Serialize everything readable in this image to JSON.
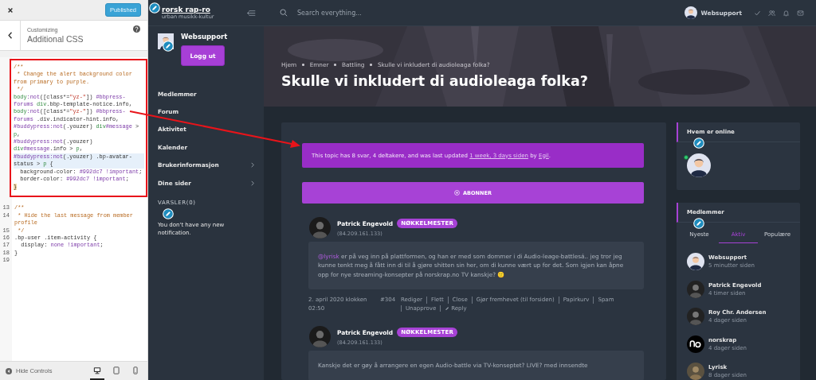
{
  "customizer": {
    "published_button": "Published",
    "breadcrumb": "Customizing",
    "title": "Additional CSS",
    "highlighted_lines": [
      {
        "active": false,
        "tokens": [
          {
            "kind": "comment",
            "t": "/**"
          }
        ]
      },
      {
        "active": false,
        "tokens": [
          {
            "kind": "comment",
            "t": " * Change the alert background color from primary to purple."
          }
        ]
      },
      {
        "active": false,
        "tokens": [
          {
            "kind": "comment",
            "t": " */"
          }
        ]
      },
      {
        "active": false,
        "tokens": [
          {
            "kind": "tag",
            "t": "body"
          },
          {
            "kind": "keyword",
            "t": ":not"
          },
          {
            "kind": "plain",
            "t": "([class*="
          },
          {
            "kind": "string",
            "t": "\"yz-\""
          },
          {
            "kind": "plain",
            "t": "]) "
          },
          {
            "kind": "keyword",
            "t": "#bbpress-forums"
          },
          {
            "kind": "tag",
            "t": " div"
          },
          {
            "kind": "plain",
            "t": ".bbp-template-notice.info,"
          }
        ]
      },
      {
        "active": false,
        "tokens": [
          {
            "kind": "tag",
            "t": "body"
          },
          {
            "kind": "keyword",
            "t": ":not"
          },
          {
            "kind": "plain",
            "t": "([class*="
          },
          {
            "kind": "string",
            "t": "\"yz-\""
          },
          {
            "kind": "plain",
            "t": "]) "
          },
          {
            "kind": "keyword",
            "t": "#bbpress-forums"
          },
          {
            "kind": "plain",
            "t": " .div.indicator-hint.info,"
          }
        ]
      },
      {
        "active": false,
        "tokens": [
          {
            "kind": "keyword",
            "t": "#buddypress"
          },
          {
            "kind": "keyword",
            "t": ":not"
          },
          {
            "kind": "plain",
            "t": "(.youzer) "
          },
          {
            "kind": "tag",
            "t": "div"
          },
          {
            "kind": "keyword",
            "t": "#message"
          },
          {
            "kind": "plain",
            "t": " > "
          },
          {
            "kind": "tag",
            "t": "p"
          },
          {
            "kind": "plain",
            "t": ","
          }
        ]
      },
      {
        "active": false,
        "tokens": [
          {
            "kind": "keyword",
            "t": "#buddypress"
          },
          {
            "kind": "keyword",
            "t": ":not"
          },
          {
            "kind": "plain",
            "t": "(.youzer) "
          },
          {
            "kind": "tag",
            "t": "div"
          },
          {
            "kind": "keyword",
            "t": "#message"
          },
          {
            "kind": "plain",
            "t": ".info > "
          },
          {
            "kind": "tag",
            "t": "p"
          },
          {
            "kind": "plain",
            "t": ","
          }
        ]
      },
      {
        "active": true,
        "tokens": [
          {
            "kind": "keyword",
            "t": "#buddypress"
          },
          {
            "kind": "keyword",
            "t": ":not"
          },
          {
            "kind": "plain",
            "t": "(.youzer) .bp-avatar-status > "
          },
          {
            "kind": "tag",
            "t": "p"
          },
          {
            "kind": "plain",
            "t": " {"
          }
        ]
      },
      {
        "active": false,
        "tokens": [
          {
            "kind": "plain",
            "t": "  background-color: "
          },
          {
            "kind": "keyword",
            "t": "#992dc7 !important"
          },
          {
            "kind": "plain",
            "t": ";"
          }
        ]
      },
      {
        "active": false,
        "tokens": [
          {
            "kind": "plain",
            "t": "  border-color: "
          },
          {
            "kind": "keyword",
            "t": "#992dc7 !important"
          },
          {
            "kind": "plain",
            "t": ";"
          }
        ]
      },
      {
        "active": false,
        "tokens": [
          {
            "kind": "bracket",
            "t": "}"
          }
        ]
      }
    ],
    "other_lines": [
      {
        "active": false
      },
      {
        "number": "13",
        "active": false,
        "tokens": [
          {
            "kind": "comment",
            "t": "/**"
          }
        ]
      },
      {
        "number": "14",
        "active": false,
        "tokens": [
          {
            "kind": "comment",
            "t": " * Hide the last message from member profile"
          }
        ]
      },
      {
        "number": "15",
        "active": false,
        "tokens": [
          {
            "kind": "comment",
            "t": " */"
          }
        ]
      },
      {
        "number": "16",
        "active": false,
        "tokens": [
          {
            "kind": "plain",
            "t": ".bp-user .item-activity {"
          }
        ]
      },
      {
        "number": "17",
        "active": false,
        "tokens": [
          {
            "kind": "plain",
            "t": "  display: "
          },
          {
            "kind": "keyword",
            "t": "none !important"
          },
          {
            "kind": "plain",
            "t": ";"
          }
        ]
      },
      {
        "number": "18",
        "active": false,
        "tokens": [
          {
            "kind": "plain",
            "t": "}"
          }
        ]
      },
      {
        "number": "19",
        "active": false
      }
    ],
    "hide_controls": "Hide Controls",
    "devices": [
      {
        "kind": "desktop",
        "selected": true
      },
      {
        "kind": "tablet",
        "selected": false
      },
      {
        "kind": "mobile",
        "selected": false
      }
    ]
  },
  "header": {
    "logo": "rorsk rap-ro",
    "tagline": "urban musikk-kultur",
    "search": {
      "placeholder": "Search everything..."
    },
    "user": "Websupport"
  },
  "sidebar": {
    "user": "Websupport",
    "logout_button": "Logg ut",
    "items": [
      {
        "label": "Medlemmer",
        "expandable": false
      },
      {
        "label": "Forum",
        "expandable": false
      },
      {
        "label": "Aktivitet",
        "expandable": false
      },
      {
        "label": "Kalender",
        "expandable": false
      },
      {
        "label": "Brukerinformasjon",
        "expandable": true
      },
      {
        "label": "Dine sider",
        "expandable": true
      }
    ],
    "notifications_heading": "VARSLER(0)",
    "notifications_text": "You don't have any new notification."
  },
  "hero": {
    "breadcrumbs": [
      "Hjem",
      "Emner",
      "Battling",
      "Skulle vi inkludert di audioleaga folka?"
    ],
    "title": "Skulle vi inkludert di audioleaga folka?"
  },
  "notice": {
    "parts": [
      {
        "text": "This topic has 8 svar, 4 deltakere, and was last updated ",
        "link": false
      },
      {
        "text": "1 week, 3 days siden",
        "link": true
      },
      {
        "text": " by ",
        "link": false
      },
      {
        "text": "Egil",
        "link": true
      },
      {
        "text": ".",
        "link": false
      }
    ]
  },
  "subscribe_button": "ABONNER",
  "posts": [
    {
      "author": "Patrick Engevold",
      "badge": "NØKKELMESTER",
      "ip": "(84.209.161.133)",
      "mention": "@lyrisk",
      "body": " er på veg inn på plattformen, og han er med som dommer i di Audio-leage-battlesá.. jeg tror jeg kunne tenkt meg å fått inn di til å gjøre shitten sin her, om di kunne vært up for det. Som igjen kan åpne opp for nye streaming-konsepter på norskrap.no TV kanskje? 🙂",
      "date": "2. april 2020 klokken 02:50",
      "number": "#304",
      "actions": [
        "Rediger",
        "Flett",
        "Close",
        "Gjør fremhevet (til forsiden)",
        "Papirkurv",
        "Spam",
        "Unapprove"
      ],
      "reply": "Reply"
    },
    {
      "author": "Patrick Engevold",
      "badge": "NØKKELMESTER",
      "ip": "(84.209.161.133)",
      "body": "Kanskje det er gøy å arrangere en egen Audio-battle via TV-konseptet? LIVE? med innsendte"
    }
  ],
  "online_widget": {
    "title": "Hvem er online",
    "users": [
      {
        "online": true
      }
    ]
  },
  "members_widget": {
    "title": "Medlemmer",
    "tabs": [
      {
        "label": "Nyeste",
        "selected": false
      },
      {
        "label": "Aktiv",
        "selected": true
      },
      {
        "label": "Populære",
        "selected": false
      }
    ],
    "members": [
      {
        "name": "Websupport",
        "time": "5 minutter siden",
        "kind": "cartoon"
      },
      {
        "name": "Patrick Engevold",
        "time": "4 timer siden"
      },
      {
        "name": "Roy Chr. Andersen",
        "time": "4 dager siden"
      },
      {
        "name": "norskrap",
        "time": "4 dager siden",
        "kind": "logo"
      },
      {
        "name": "Lyrisk",
        "time": "8 dager siden"
      }
    ]
  }
}
